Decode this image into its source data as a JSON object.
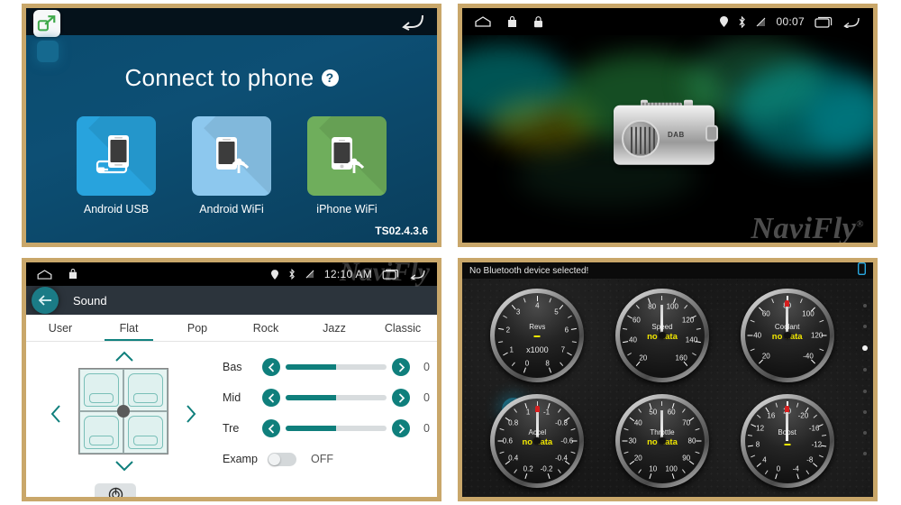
{
  "connect_panel": {
    "app_icon": "share-link-icon",
    "back_icon": "back-arrow-icon",
    "title": "Connect to phone",
    "help_icon": "help-question-icon",
    "version": "TS02.4.3.6",
    "tiles": [
      {
        "label": "Android USB",
        "icon": "phone-usb-cable-icon",
        "color": "#28a3dd"
      },
      {
        "label": "Android WiFi",
        "icon": "phone-wifi-icon",
        "color": "#8dc8ee"
      },
      {
        "label": "iPhone WiFi",
        "icon": "iphone-wifi-icon",
        "color": "#6fae5c"
      }
    ]
  },
  "radio_panel": {
    "statusbar": {
      "left_icons": [
        "home-icon",
        "bag-icon",
        "lock-icon"
      ],
      "right_icons": [
        "location-icon",
        "bluetooth-icon",
        "signal-off-icon"
      ],
      "time": "00:07",
      "recents_icon": "recents-icon",
      "back_icon": "back-arrow-icon"
    },
    "device_label": "DAB",
    "watermark": "NaviFly",
    "watermark_mark": "®"
  },
  "sound_panel": {
    "statusbar": {
      "left_icons": [
        "home-icon",
        "bag-icon"
      ],
      "right_icons": [
        "location-icon",
        "bluetooth-icon",
        "signal-off-icon"
      ],
      "time": "12:10 AM",
      "recents_icon": "recents-icon",
      "back_icon": "back-arrow-icon"
    },
    "header": {
      "back_icon": "back-arrow-circle-icon",
      "title": "Sound"
    },
    "tabs": [
      {
        "label": "User",
        "active": false
      },
      {
        "label": "Flat",
        "active": true
      },
      {
        "label": "Pop",
        "active": false
      },
      {
        "label": "Rock",
        "active": false
      },
      {
        "label": "Jazz",
        "active": false
      },
      {
        "label": "Classic",
        "active": false
      }
    ],
    "fader": {
      "up_icon": "chevron-up-icon",
      "down_icon": "chevron-down-icon",
      "left_icon": "chevron-left-icon",
      "right_icon": "chevron-right-icon",
      "reset_icon": "reset-icon"
    },
    "sliders": [
      {
        "name": "Bas",
        "value": "0",
        "fill_pct": 50,
        "dec_icon": "chevron-left-icon",
        "inc_icon": "chevron-right-icon"
      },
      {
        "name": "Mid",
        "value": "0",
        "fill_pct": 50,
        "dec_icon": "chevron-left-icon",
        "inc_icon": "chevron-right-icon"
      },
      {
        "name": "Tre",
        "value": "0",
        "fill_pct": 50,
        "dec_icon": "chevron-left-icon",
        "inc_icon": "chevron-right-icon"
      }
    ],
    "toggle": {
      "name": "Examp",
      "state": "OFF",
      "on": false
    },
    "watermark": "NaviFly"
  },
  "obd_panel": {
    "status_message": "No Bluetooth device selected!",
    "bt_device_icon": "phone-icon",
    "bt_device_color": "#29a8e0",
    "page_dots": {
      "count": 8,
      "active_index": 2
    },
    "gauges": [
      {
        "name": "Revs",
        "sub": "x1000",
        "reading": "",
        "min": 0,
        "max": 8,
        "numbers": [
          "0",
          "1",
          "2",
          "3",
          "4",
          "5",
          "6",
          "7",
          "8"
        ],
        "needle_deg": 0,
        "needle_hidden": true,
        "has_dash": true
      },
      {
        "name": "Speed",
        "sub": "",
        "reading": "no data",
        "min": 0,
        "max": 180,
        "numbers": [
          "20",
          "40",
          "60",
          "80",
          "100",
          "120",
          "140",
          "160"
        ],
        "needle_deg": 180,
        "needle_hidden": false,
        "has_dash": false
      },
      {
        "name": "Coolant",
        "sub": "",
        "reading": "no data",
        "min": -40,
        "max": 140,
        "numbers": [
          "20",
          "40",
          "60",
          "80",
          "100",
          "120",
          "-40"
        ],
        "needle_deg": 180,
        "needle_hidden": false,
        "has_dash": false
      },
      {
        "name": "Accel",
        "sub": "",
        "reading": "no data",
        "min": -1,
        "max": 1,
        "numbers": [
          "0.2",
          "0.4",
          "0.6",
          "0.8",
          "1",
          "-1",
          "-0.8",
          "-0.6",
          "-0.4",
          "-0.2"
        ],
        "needle_deg": 180,
        "needle_hidden": false,
        "has_dash": false
      },
      {
        "name": "Throttle",
        "sub": "",
        "reading": "no data",
        "min": 0,
        "max": 110,
        "numbers": [
          "10",
          "20",
          "30",
          "40",
          "50",
          "60",
          "70",
          "80",
          "90",
          "100"
        ],
        "needle_deg": 180,
        "needle_hidden": false,
        "has_dash": false
      },
      {
        "name": "Boost",
        "sub": "",
        "reading": "",
        "min": -20,
        "max": 20,
        "numbers": [
          "0",
          "4",
          "8",
          "12",
          "16",
          "20",
          "-20",
          "-16",
          "-12",
          "-8",
          "-4"
        ],
        "needle_deg": 180,
        "needle_hidden": false,
        "has_dash": true
      }
    ]
  }
}
